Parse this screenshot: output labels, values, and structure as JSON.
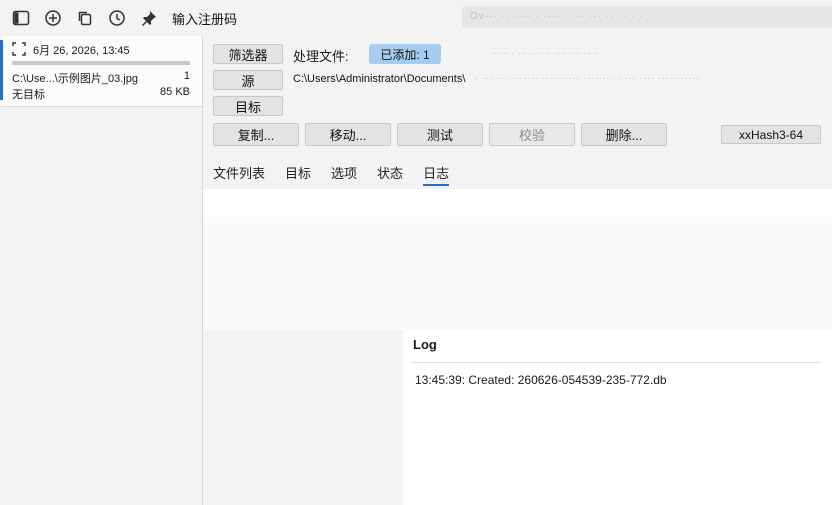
{
  "toolbar": {
    "icons": [
      "sidebar-toggle-icon",
      "add-icon",
      "copy-icon",
      "history-icon",
      "pin-icon"
    ],
    "title": "输入注册码",
    "blurred_text": "Ov··· ·· ···· · ···· · ··· ··· ·· ·· · ·"
  },
  "jobs": [
    {
      "date": "6月 26, 2026, 13:45",
      "file": "C:\\Use...\\示例图片_03.jpg",
      "count": "1",
      "target": "无目标",
      "size": "85 KB"
    }
  ],
  "main": {
    "filter_button": "筛选器",
    "processing_label": "处理文件:",
    "added_badge": "已添加: 1",
    "blurred_right": "· ·· · ·· ·· · · ··· · · ·· ·",
    "source_button": "源",
    "source_path": "C:\\Users\\Administrator\\Documents\\",
    "source_path_blur": "· ··· ·· ········ ·········· ········ · ··· ···· ···········",
    "target_button": "目标",
    "actions": {
      "copy": "复制...",
      "move": "移动...",
      "test": "测试",
      "verify": "校验",
      "delete": "删除...",
      "hash": "xxHash3-64"
    },
    "tabs": [
      "文件列表",
      "目标",
      "选项",
      "状态",
      "日志"
    ],
    "active_tab": 4,
    "log": {
      "title": "Log",
      "entries": [
        "13:45:39: Created: 260626-054539-235-772.db"
      ]
    }
  },
  "colors": {
    "accent": "#1f73c9",
    "badge": "#a6cdf0"
  }
}
